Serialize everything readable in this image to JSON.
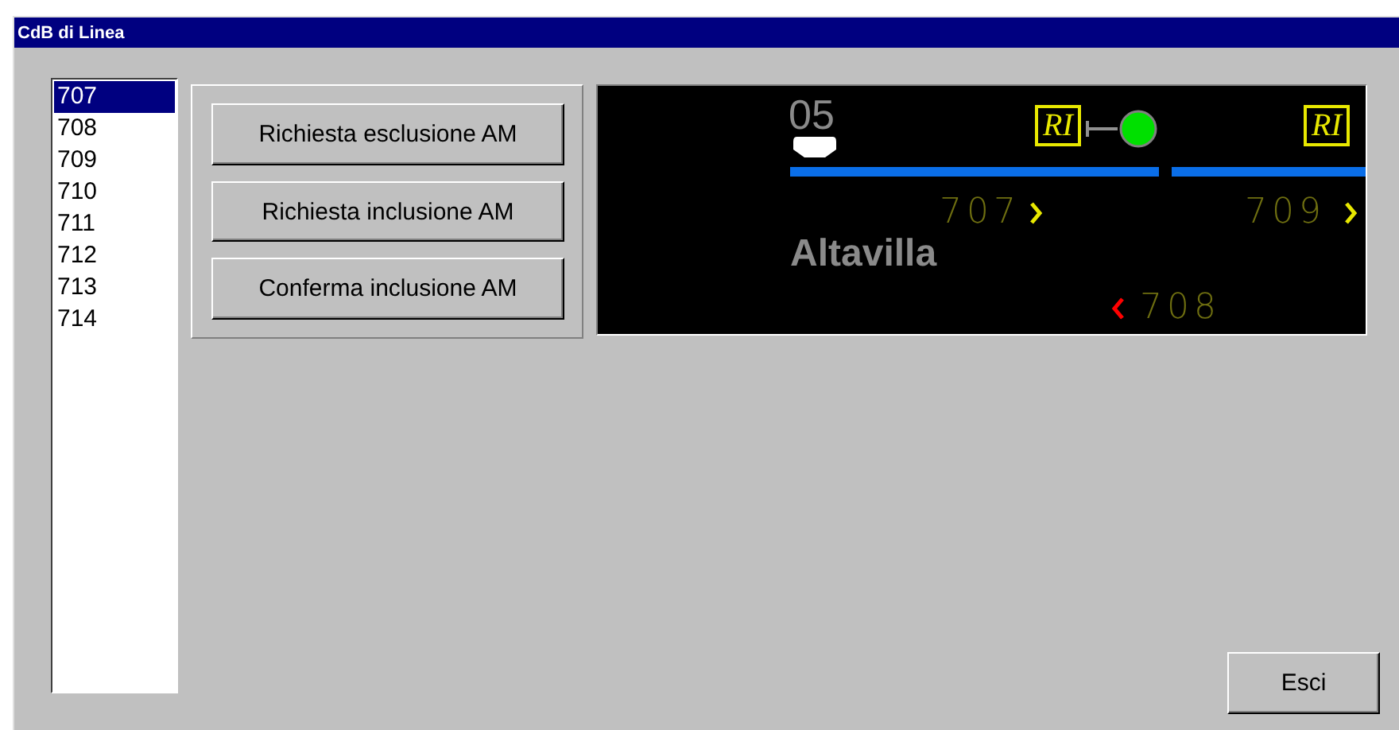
{
  "window": {
    "title": "CdB di Linea"
  },
  "list": [
    {
      "label": "707",
      "selected": true
    },
    {
      "label": "708",
      "selected": false
    },
    {
      "label": "709",
      "selected": false
    },
    {
      "label": "710",
      "selected": false
    },
    {
      "label": "711",
      "selected": false
    },
    {
      "label": "712",
      "selected": false
    },
    {
      "label": "713",
      "selected": false
    },
    {
      "label": "714",
      "selected": false
    }
  ],
  "actions": [
    "Richiesta esclusione AM",
    "Richiesta inclusione AM",
    "Conferma inclusione AM"
  ],
  "schematic": {
    "platform": "05",
    "station": "Altavilla",
    "route_marks": [
      {
        "label": "RI",
        "kind": "signal"
      },
      {
        "label": "RI",
        "kind": "plain"
      }
    ],
    "tracks": [
      {
        "label": "707",
        "kind": "forward",
        "color": "#e8e800"
      },
      {
        "label": "709",
        "kind": "forward",
        "color": "#e8e800"
      },
      {
        "label": "708",
        "kind": "reverse",
        "color": "#ff0000"
      }
    ]
  },
  "exit_button": "Esci"
}
